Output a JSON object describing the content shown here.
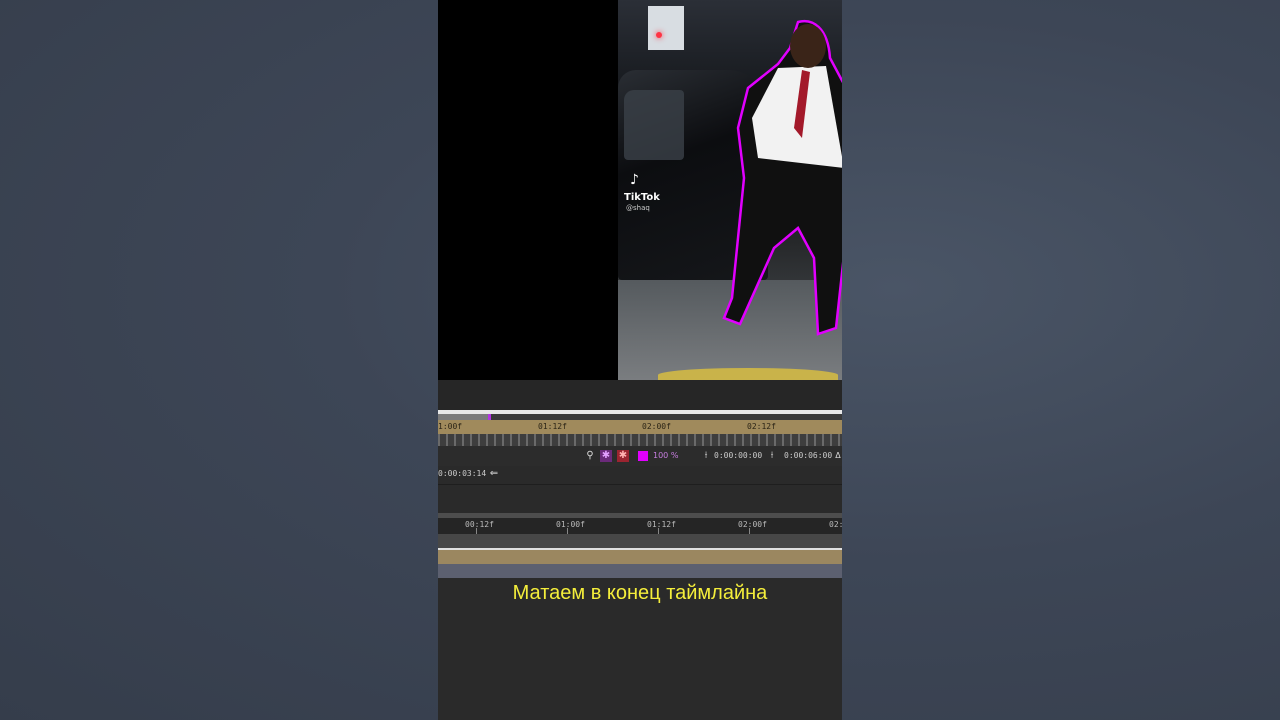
{
  "preview": {
    "watermark_brand": "TikTok",
    "watermark_handle": "@shaq",
    "mask_color": "#e100ff"
  },
  "timeline": {
    "ruler_top": [
      "1:00f",
      "01:12f",
      "02:00f",
      "02:12f"
    ],
    "zoom_percent": "100 %",
    "in_time": "0:00:00:00",
    "out_time": "0:00:06:00",
    "current_time": "0:00:03:14",
    "ruler_bottom": [
      "00:12f",
      "01:00f",
      "01:12f",
      "02:00f",
      "02:"
    ]
  },
  "caption": "Матаем в конец таймлайна",
  "colors": {
    "accent_caption": "#f4ee3b",
    "track_gold": "#9b8760"
  }
}
